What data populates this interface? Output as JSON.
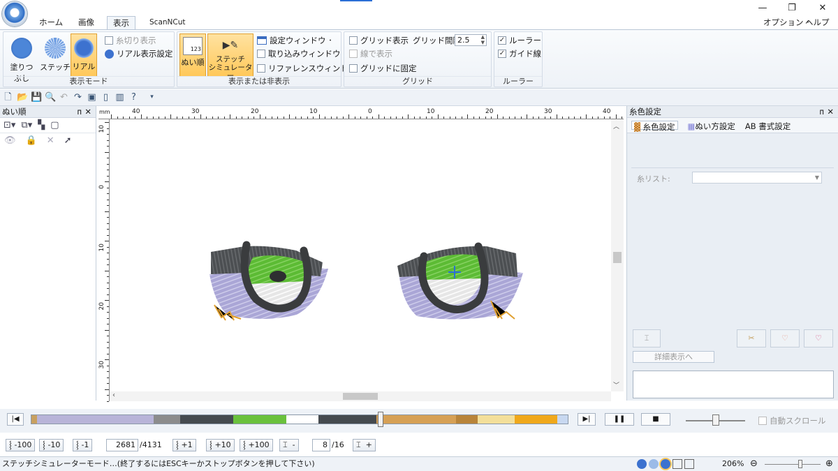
{
  "window": {
    "minimize": "—",
    "maximize": "❐",
    "close": "✕"
  },
  "tabs": {
    "home": "ホーム",
    "image": "画像",
    "view": "表示",
    "scanncut": "ScanNCut",
    "options": "オプション ･",
    "help": "ヘルプ ･"
  },
  "ribbon": {
    "display_mode": {
      "label": "表示モード",
      "fill": "塗りつぶし",
      "stitch": "ステッチ",
      "real": "リアル",
      "thread_cut": "糸切り表示",
      "real_settings": "リアル表示設定"
    },
    "show_hide": {
      "label": "表示または非表示",
      "sew_order": "ぬい順",
      "stitch_sim": "ステッチ\nシミュレーター",
      "stitch_sim_l1": "ステッチ",
      "stitch_sim_l2": "シミュレーター",
      "settings_window": "設定ウィンドウ ･",
      "import_window": "取り込みウィンドウ",
      "reference_window": "リファレンスウィンドウ"
    },
    "grid": {
      "label": "グリッド",
      "show_grid": "グリッド表示",
      "grid_interval": "グリッド間隔:",
      "interval_value": "2.5",
      "show_lines": "線で表示",
      "snap_grid": "グリッドに固定"
    },
    "ruler": {
      "label": "ルーラー",
      "ruler": "ルーラー",
      "guide": "ガイド線"
    }
  },
  "left_pane": {
    "title": "ぬい順",
    "pin": "ᴨ",
    "close": "✕"
  },
  "right_pane": {
    "title": "糸色設定",
    "tab_color": "糸色設定",
    "tab_sew": "ぬい方設定",
    "tab_font": "AB 書式設定",
    "thread_list": "糸リスト:",
    "detail_button": "詳細表示へ"
  },
  "ruler": {
    "top_unit": "mm",
    "top_labels": [
      "40",
      "30",
      "20",
      "10",
      "0",
      "10",
      "20",
      "30",
      "40"
    ],
    "left_labels": [
      "10",
      "0",
      "10",
      "20",
      "30"
    ]
  },
  "simulator": {
    "stitch_current": "2681",
    "stitch_total": "/4131",
    "color_current": "8",
    "color_total": "/16",
    "auto_scroll": "自動スクロール",
    "progress_fraction": 0.65,
    "thread_colors": [
      "#c8a060",
      "#b8b4d8",
      "#8c8c8c",
      "#454a4f",
      "#6ac13c",
      "#ffffff",
      "#454a4f",
      "#d6a055",
      "#b8843a",
      "#f3df9a",
      "#f0a81b",
      "#c8d8f0"
    ]
  },
  "step_buttons": [
    "-100",
    "-10",
    "-1",
    "+1",
    "+10",
    "+100"
  ],
  "status": {
    "message": "ステッチシミュレーターモード…(終了するにはESCキーかストップボタンを押して下さい)",
    "zoom": "206%"
  },
  "colors": {
    "accent": "#2b6fd6",
    "ribbon_selected": "#ffc85a"
  }
}
